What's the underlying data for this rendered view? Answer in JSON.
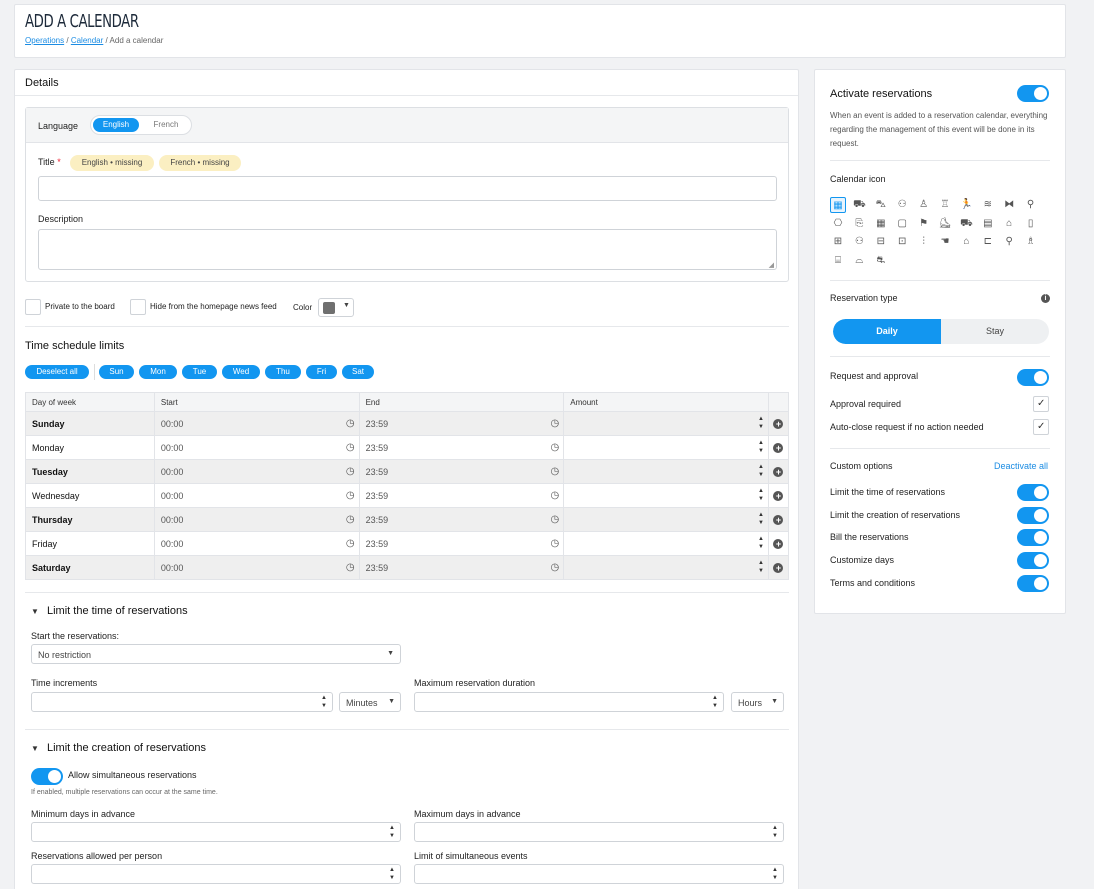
{
  "header": {
    "title": "ADD A CALENDAR",
    "breadcrumb": [
      "Operations",
      "Calendar",
      "Add a calendar"
    ]
  },
  "details": {
    "heading": "Details",
    "language_label": "Language",
    "languages": [
      "English",
      "French"
    ],
    "title_label": "Title",
    "required_mark": "*",
    "title_tags": [
      "English • missing",
      "French • missing"
    ],
    "description_label": "Description",
    "private_label": "Private to the board",
    "hide_label": "Hide from the homepage news feed",
    "color_label": "Color",
    "color_value": "#6f6f6f"
  },
  "schedule": {
    "heading": "Time schedule limits",
    "deselect_all": "Deselect all",
    "days_short": [
      "Sun",
      "Mon",
      "Tue",
      "Wed",
      "Thu",
      "Fri",
      "Sat"
    ],
    "columns": [
      "Day of week",
      "Start",
      "End",
      "Amount"
    ],
    "rows": [
      {
        "day": "Sunday",
        "start": "00:00",
        "end": "23:59"
      },
      {
        "day": "Monday",
        "start": "00:00",
        "end": "23:59"
      },
      {
        "day": "Tuesday",
        "start": "00:00",
        "end": "23:59"
      },
      {
        "day": "Wednesday",
        "start": "00:00",
        "end": "23:59"
      },
      {
        "day": "Thursday",
        "start": "00:00",
        "end": "23:59"
      },
      {
        "day": "Friday",
        "start": "00:00",
        "end": "23:59"
      },
      {
        "day": "Saturday",
        "start": "00:00",
        "end": "23:59"
      }
    ]
  },
  "limit_time": {
    "heading": "Limit the time of reservations",
    "start_label": "Start the reservations:",
    "start_value": "No restriction",
    "increments_label": "Time increments",
    "increments_unit": "Minutes",
    "max_duration_label": "Maximum reservation duration",
    "max_duration_unit": "Hours"
  },
  "limit_creation": {
    "heading": "Limit the creation of reservations",
    "simultaneous_label": "Allow simultaneous reservations",
    "simultaneous_help": "If enabled, multiple reservations can occur at the same time.",
    "min_days_label": "Minimum days in advance",
    "max_days_label": "Maximum days in advance",
    "per_person_label": "Reservations allowed per person",
    "simultaneous_events_label": "Limit of simultaneous events"
  },
  "sidebar": {
    "activate_label": "Activate reservations",
    "activate_help": "When an event is added to a reservation calendar, everything regarding the management of this event will be done in its request.",
    "icon_label": "Calendar icon",
    "reservation_type_label": "Reservation type",
    "type_options": [
      "Daily",
      "Stay"
    ],
    "request_label": "Request and approval",
    "approval_label": "Approval required",
    "autoclose_label": "Auto-close request if no action needed",
    "custom_label": "Custom options",
    "deactivate_all": "Deactivate all",
    "options": [
      "Limit the time of reservations",
      "Limit the creation of reservations",
      "Bill the reservations",
      "Customize days",
      "Terms and conditions"
    ]
  },
  "icons": [
    "calendar-icon",
    "truck-icon",
    "bus-icon",
    "people-icon",
    "person-icon",
    "stamp-icon",
    "runner-icon",
    "swim-icon",
    "dumbbell-icon",
    "bike-icon",
    "gift-icon",
    "ticket-icon",
    "calendar-alt-icon",
    "clipboard-icon",
    "flag-icon",
    "skate-icon",
    "car-icon",
    "building-icon",
    "warehouse-icon",
    "door-icon",
    "boxes-icon",
    "group-icon",
    "shop-icon",
    "tag-icon",
    "stairs-icon",
    "hand-icon",
    "home-icon",
    "bed-icon",
    "pin-icon",
    "climber-icon",
    "garage-icon",
    "gate-icon",
    "cars-icon"
  ]
}
